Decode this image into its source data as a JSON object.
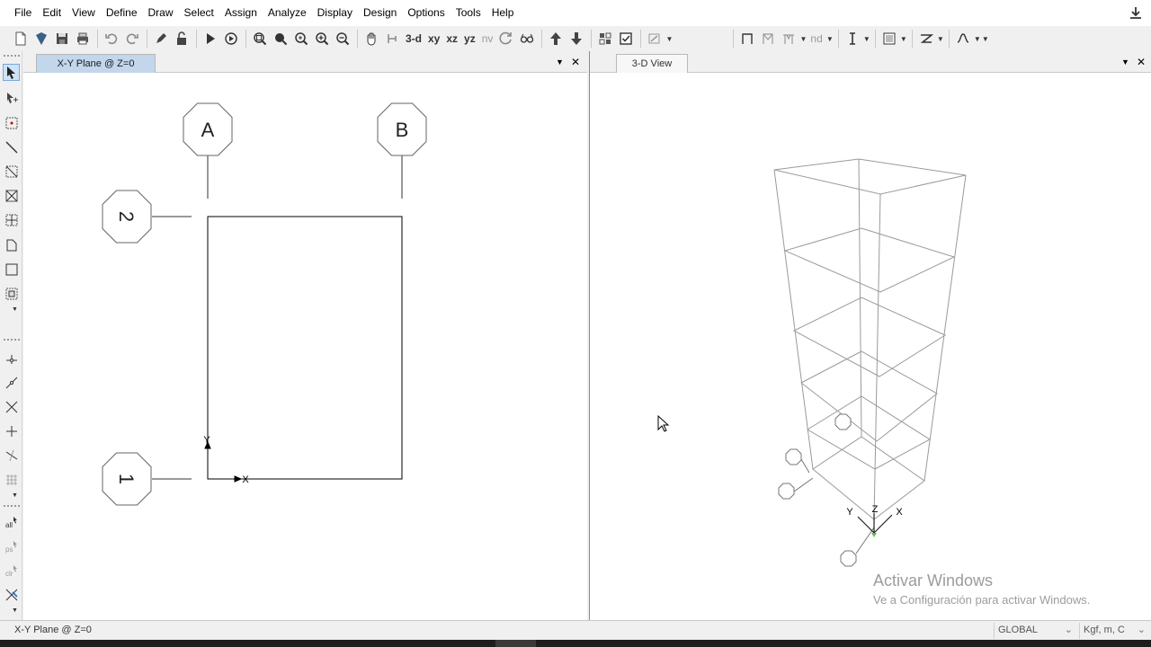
{
  "menu": [
    "File",
    "Edit",
    "View",
    "Define",
    "Draw",
    "Select",
    "Assign",
    "Analyze",
    "Display",
    "Design",
    "Options",
    "Tools",
    "Help"
  ],
  "toolbar": {
    "view_3d": "3-d",
    "view_xy": "xy",
    "view_xz": "xz",
    "view_yz": "yz",
    "view_nv": "nv",
    "nd": "nd",
    "icons": [
      "new-file-icon",
      "open-icon",
      "save-icon",
      "print-icon",
      "undo-icon",
      "redo-icon",
      "edit-pencil-icon",
      "lock-icon",
      "run-analysis-icon",
      "animate-icon",
      "zoom-window-icon",
      "restore-view-icon",
      "zoom-previous-icon",
      "zoom-in-icon",
      "zoom-out-icon",
      "pan-icon",
      "rubber-band-icon",
      "rotate-icon",
      "perspective-icon",
      "move-up-icon",
      "move-down-icon",
      "object-shrink-icon",
      "set-display-icon",
      "options-icon",
      "draw-frame-icon",
      "select-text-icon",
      "display-icon",
      "section-icon",
      "spline-icon"
    ]
  },
  "left_pane": {
    "tab": "X-Y Plane @ Z=0",
    "grid_bubbles": [
      "A",
      "B",
      "2",
      "1"
    ],
    "axis_x": "X",
    "axis_y": "Y"
  },
  "right_pane": {
    "tab": "3-D View",
    "axis_labels": [
      "Y",
      "Z",
      "X"
    ]
  },
  "status": {
    "text": "X-Y Plane @ Z=0",
    "coord_system": "GLOBAL",
    "units": "Kgf, m, C"
  },
  "watermark": {
    "line1": "Activar Windows",
    "line2": "Ve a Configuración para activar Windows."
  }
}
